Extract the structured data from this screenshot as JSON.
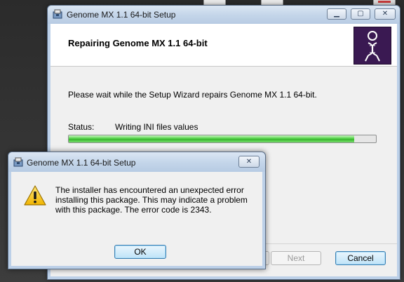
{
  "main_window": {
    "title": "Genome MX 1.1 64-bit Setup",
    "banner_title": "Repairing Genome MX 1.1 64-bit",
    "info_text": "Please wait while the Setup Wizard repairs Genome MX 1.1 64-bit.",
    "status_label": "Status:",
    "status_value": "Writing INI files values",
    "progress_fraction": 0.93,
    "buttons": {
      "next": "Next",
      "cancel": "Cancel"
    },
    "icons": {
      "app": "installer-icon",
      "logo": "dna-person-logo"
    }
  },
  "error_dialog": {
    "title": "Genome MX 1.1 64-bit Setup",
    "message": "The installer has encountered an unexpected error installing this package. This may indicate a problem with this package. The error code is 2343.",
    "ok_label": "OK",
    "icons": {
      "warning": "warning-icon"
    }
  },
  "colors": {
    "progress_green": "#35b52b",
    "logo_purple": "#3a1952",
    "warning_yellow": "#f5c518"
  }
}
